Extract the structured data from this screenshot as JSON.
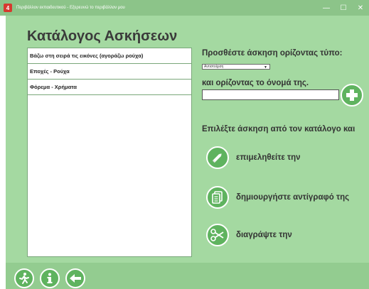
{
  "window": {
    "title": "Περιβάλλον εκπαιδευτικού - Εξερευνώ το περιβάλλον μου",
    "app_icon_glyph": "4",
    "minimize_glyph": "—",
    "maximize_glyph": "☐",
    "close_glyph": "✕"
  },
  "catalog": {
    "title": "Κατάλογος Ασκήσεων",
    "items": [
      {
        "label": "Βάζω στη σειρά τις εικόνες (αγοράζω ρούχα)"
      },
      {
        "label": "Εποχές - Ρούχα"
      },
      {
        "label": "Φόρεμα - Χρήματα"
      }
    ]
  },
  "add_panel": {
    "type_label": "Προσθέστε άσκηση ορίζοντας τύπο:",
    "type_select_value": "Αντιστοίχιση",
    "name_label": "και ορίζοντας το όνομά της.",
    "name_value": "",
    "add_icon": "plus-icon"
  },
  "actions": {
    "choose_label": "Επιλέξτε άσκηση από τον κατάλογο και",
    "edit_label": "επιμεληθείτε την",
    "copy_label": "δημιουργήστε αντίγραφό της",
    "delete_label": "διαγράψτε την"
  },
  "colors": {
    "titlebar": "#8cc489",
    "background": "#a4d9a1",
    "button_green": "#5fb35f",
    "app_icon": "#d63a2f"
  }
}
